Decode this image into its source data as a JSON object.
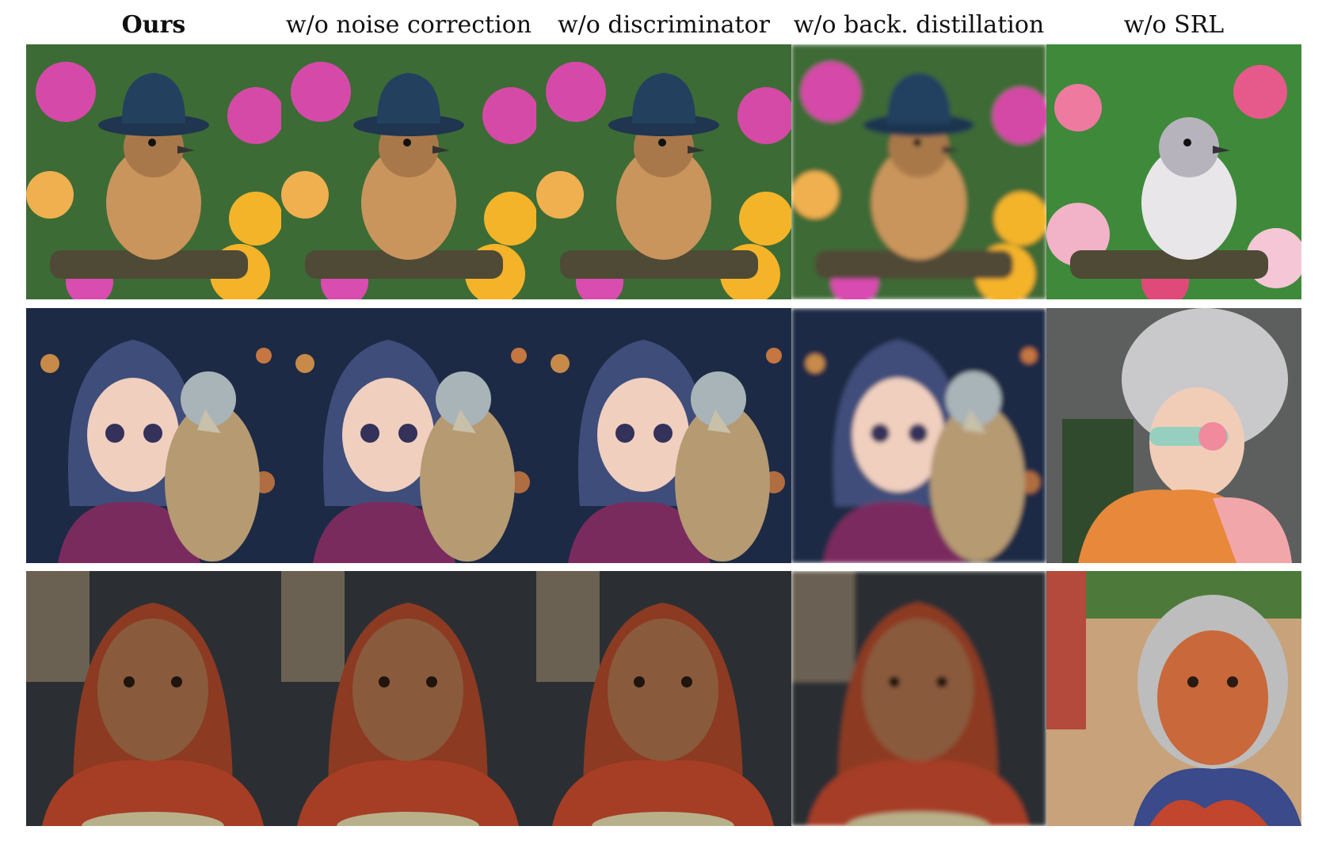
{
  "columns": [
    {
      "label": "Ours",
      "bold": true
    },
    {
      "label": "w/o noise correction",
      "bold": false
    },
    {
      "label": "w/o discriminator",
      "bold": false
    },
    {
      "label": "w/o back. distillation",
      "bold": false
    },
    {
      "label": "w/o SRL",
      "bold": false
    }
  ],
  "rows": [
    {
      "subject": "bird wearing a hat among flowers"
    },
    {
      "subject": "girl hugging a bird"
    },
    {
      "subject": "portrait of an elderly woman in a red shawl"
    }
  ],
  "colors": {
    "background": "#ffffff",
    "header_text": "#111111"
  }
}
